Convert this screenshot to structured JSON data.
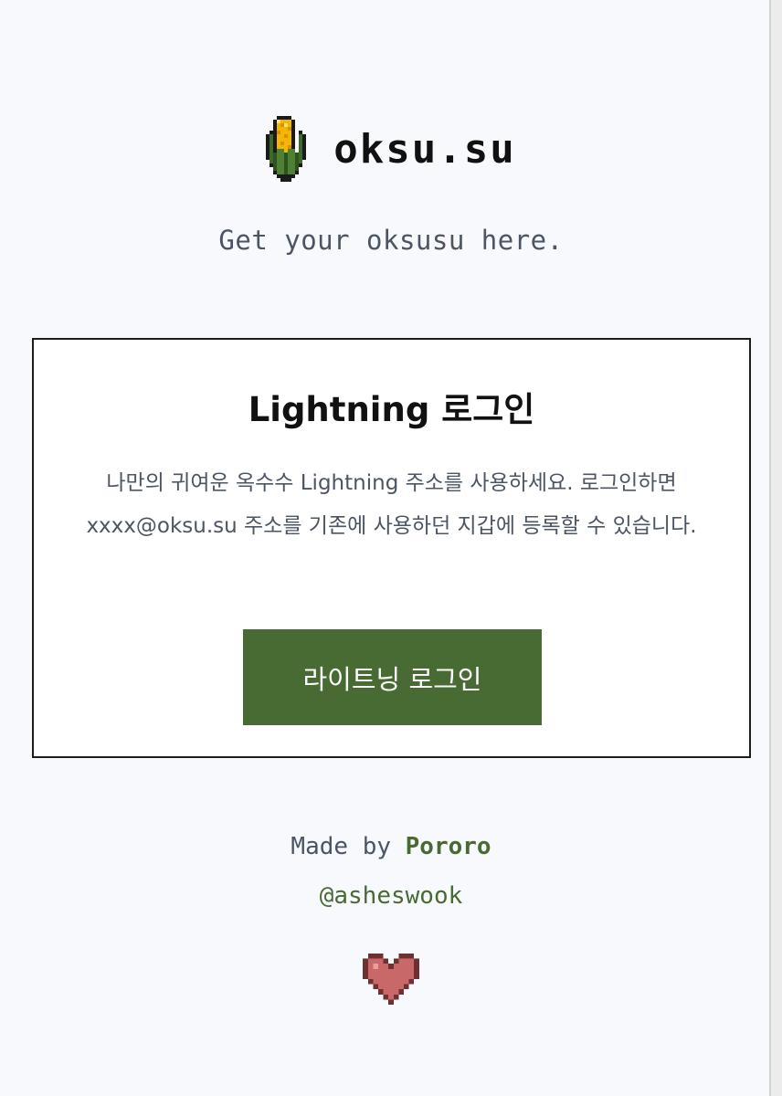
{
  "brand": {
    "name": "oksu.su",
    "icon": "corn-icon"
  },
  "tagline": "Get your oksusu here.",
  "login_card": {
    "title": "Lightning 로그인",
    "description": "나만의 귀여운 옥수수 Lightning 주소를 사용하세요. 로그인하면 xxxx@oksu.su 주소를 기존에 사용하던 지갑에 등록할 수 있습니다.",
    "button_label": "라이트닝 로그인"
  },
  "footer": {
    "made_by_prefix": "Made by ",
    "author": "Pororo",
    "handle": "@asheswook",
    "heart_icon": "heart-icon"
  },
  "colors": {
    "accent_green": "#476b33",
    "text_gray": "#4b5563",
    "heart": "#c86868",
    "background": "#f7f9fc"
  }
}
